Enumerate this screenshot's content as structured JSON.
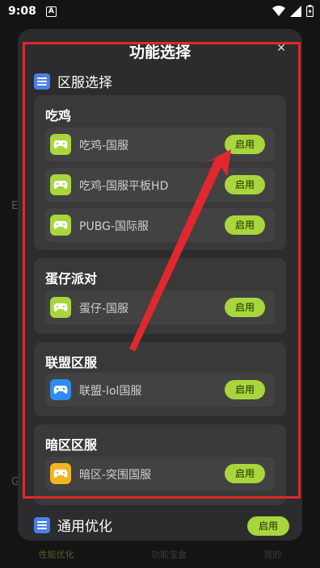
{
  "status_bar": {
    "time": "9:08",
    "notif_letter": "A"
  },
  "dialog": {
    "title": "功能选择",
    "close_icon": "close-icon",
    "section_region": "区服选择",
    "section_general": "通用优化",
    "general_button": "启用",
    "groups": [
      {
        "title": "吃鸡",
        "items": [
          {
            "label": "吃鸡-国服",
            "button": "启用",
            "icon": "gamepad-icon",
            "icon_color": "#a8d63c"
          },
          {
            "label": "吃鸡-国服平板HD",
            "button": "启用",
            "icon": "gamepad-icon",
            "icon_color": "#a8d63c"
          },
          {
            "label": "PUBG-国际服",
            "button": "启用",
            "icon": "gamepad-icon",
            "icon_color": "#a8d63c"
          }
        ]
      },
      {
        "title": "蛋仔派对",
        "items": [
          {
            "label": "蛋仔-国服",
            "button": "启用",
            "icon": "gamepad-icon",
            "icon_color": "#a8d63c"
          }
        ]
      },
      {
        "title": "联盟区服",
        "items": [
          {
            "label": "联盟-lol国服",
            "button": "启用",
            "icon": "gamepad-icon",
            "icon_color": "#2f8cf0"
          }
        ]
      },
      {
        "title": "暗区区服",
        "items": [
          {
            "label": "暗区-突围国服",
            "button": "启用",
            "icon": "gamepad-icon",
            "icon_color": "#f2b51f"
          }
        ]
      }
    ]
  },
  "background_nav": {
    "tab1": "性能优化",
    "tab2": "功能宝盒",
    "tab3": "我的"
  },
  "colors": {
    "accent_green": "#a8d63c",
    "annotation_red": "#e0282e",
    "section_blue": "#4a7fe8"
  }
}
